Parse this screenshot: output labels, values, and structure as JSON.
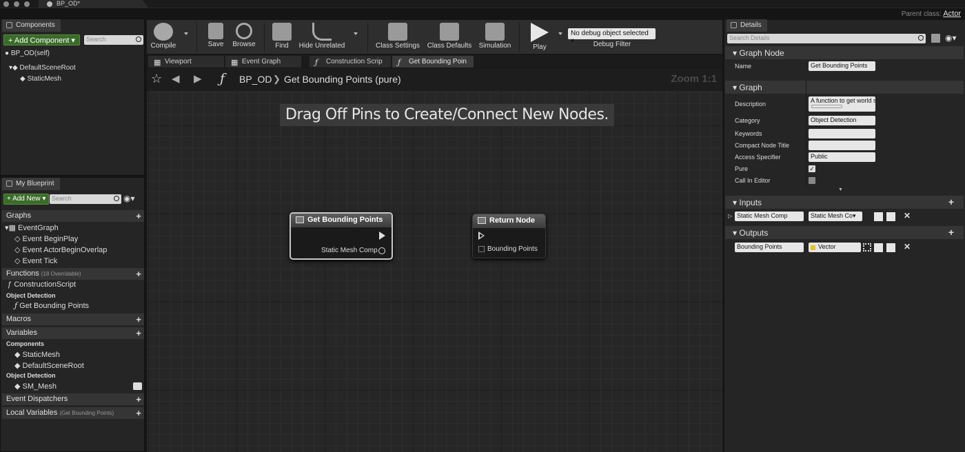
{
  "window": {
    "doc_tab": "BP_OD*",
    "parent_class_label": "Parent class:",
    "parent_class_value": "Actor"
  },
  "components": {
    "tab": "Components",
    "add_button": "+ Add Component ▾",
    "search_placeholder": "Search",
    "items": [
      "BP_OD(self)",
      "DefaultSceneRoot",
      "StaticMesh"
    ]
  },
  "my_blueprint": {
    "tab": "My Blueprint",
    "add_button": "+ Add New ▾",
    "search_placeholder": "Search",
    "graphs_label": "Graphs",
    "event_graph": "EventGraph",
    "events": [
      "Event BeginPlay",
      "Event ActorBeginOverlap",
      "Event Tick"
    ],
    "functions_label": "Functions",
    "functions_note": "(18 Overridable)",
    "construction_script": "ConstructionScript",
    "object_detection_label": "Object Detection",
    "function_item": "Get Bounding Points",
    "macros_label": "Macros",
    "variables_label": "Variables",
    "components_label": "Components",
    "component_vars": [
      "StaticMesh",
      "DefaultSceneRoot"
    ],
    "object_detection_label2": "Object Detection",
    "var_item": "SM_Mesh",
    "dispatchers_label": "Event Dispatchers",
    "local_vars_label": "Local Variables",
    "local_vars_note": "(Get Bounding Points)"
  },
  "toolbar": {
    "compile": "Compile",
    "save": "Save",
    "browse": "Browse",
    "find": "Find",
    "hide_unrelated": "Hide Unrelated",
    "class_settings": "Class Settings",
    "class_defaults": "Class Defaults",
    "simulation": "Simulation",
    "play": "Play",
    "debug_select": "No debug object selected ▾",
    "debug_filter": "Debug Filter"
  },
  "graph_tabs": [
    "Viewport",
    "Event Graph",
    "Construction Scrip",
    "Get Bounding Poin"
  ],
  "graph": {
    "breadcrumb_root": "BP_OD",
    "breadcrumb_sep": "❯",
    "breadcrumb_current": "Get Bounding Points (pure)",
    "zoom": "Zoom 1:1",
    "hint": "Drag Off Pins to Create/Connect New Nodes.",
    "node1_title": "Get Bounding Points",
    "node1_pin": "Static Mesh Comp",
    "node2_title": "Return Node",
    "node2_pin": "Bounding Points"
  },
  "details": {
    "tab": "Details",
    "search_placeholder": "Search Details",
    "graph_node_header": "Graph Node",
    "name_label": "Name",
    "name_value": "Get Bounding Points",
    "graph_header": "Graph",
    "description_label": "Description",
    "description_value": "A function to get world sp",
    "category_label": "Category",
    "category_value": "Object Detection",
    "keywords_label": "Keywords",
    "compact_label": "Compact Node Title",
    "access_label": "Access Specifier",
    "access_value": "Public",
    "pure_label": "Pure",
    "call_in_editor_label": "Call In Editor",
    "inputs_header": "Inputs",
    "input_name": "Static Mesh Comp",
    "input_type": "Static Mesh Co▾",
    "outputs_header": "Outputs",
    "output_name": "Bounding Points",
    "output_type": "Vector"
  },
  "colors": {
    "accent_green": "#3b6b2a",
    "vector_pin": "#e6c229"
  }
}
